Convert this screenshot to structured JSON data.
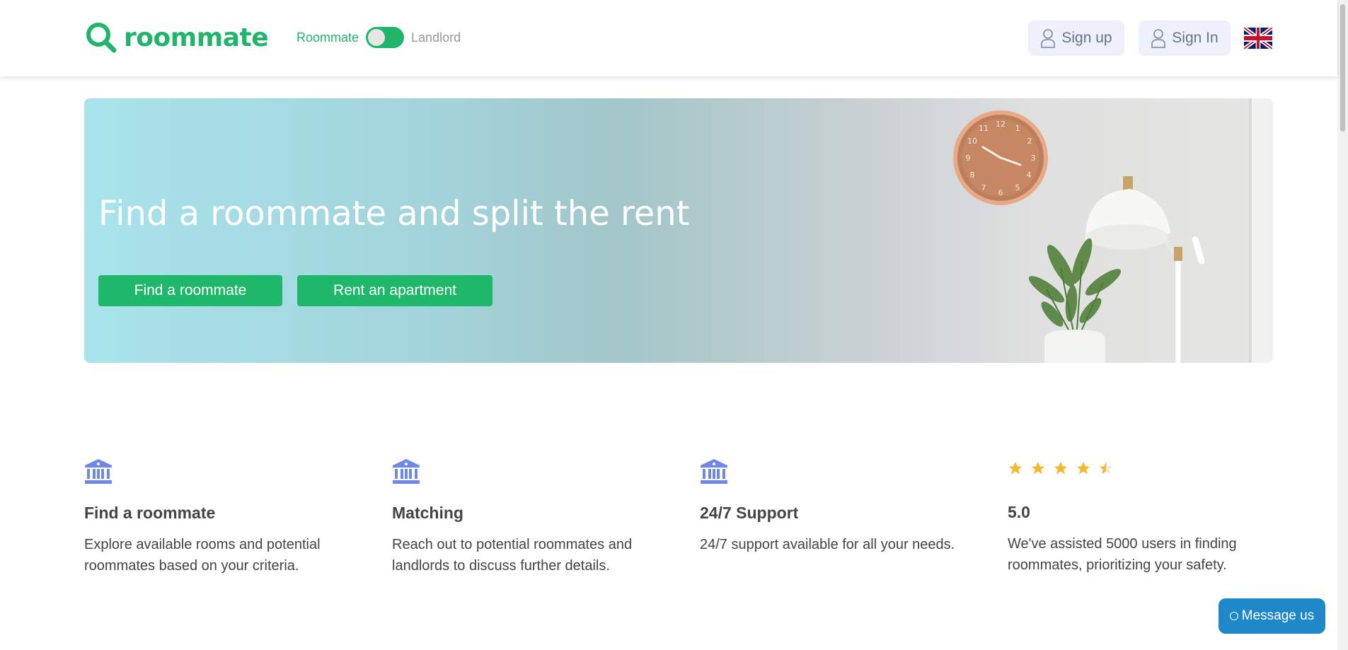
{
  "header": {
    "logo_text": "roommate",
    "toggle": {
      "left_label": "Roommate",
      "right_label": "Landlord"
    },
    "signup_label": "Sign up",
    "signin_label": "Sign In",
    "language": "uk-flag"
  },
  "hero": {
    "title": "Find a roommate and split the rent",
    "primary_button": "Find a roommate",
    "secondary_button": "Rent an apartment"
  },
  "features": [
    {
      "icon": "bank-icon",
      "title": "Find a roommate",
      "description": "Explore available rooms and potential roommates based on your criteria."
    },
    {
      "icon": "bank-icon",
      "title": "Matching",
      "description": "Reach out to potential roommates and landlords to discuss further details."
    },
    {
      "icon": "bank-icon",
      "title": "24/7 Support",
      "description": "24/7 support available for all your needs."
    },
    {
      "icon": "star-icon",
      "title": "5.0",
      "description": "We've assisted 5000 users in finding roommates, prioritizing your safety.",
      "stars": 4.5
    }
  ],
  "chat": {
    "label": "Message us"
  },
  "colors": {
    "brand": "#20b56b",
    "icon": "#6f87e8",
    "star": "#f5b82e",
    "chat": "#1e88c9"
  }
}
